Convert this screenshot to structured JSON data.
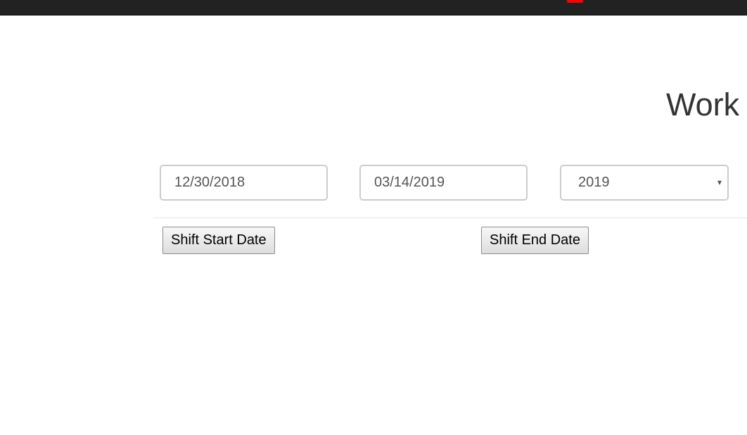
{
  "navbar": {
    "accent_color": "#ff0000"
  },
  "page": {
    "title": "Work"
  },
  "filters": {
    "start_date": "12/30/2018",
    "end_date": "03/14/2019",
    "year": "2019",
    "year_arrow": "▾"
  },
  "actions": {
    "shift_start_label": "Shift Start Date",
    "shift_end_label": "Shift End Date"
  }
}
